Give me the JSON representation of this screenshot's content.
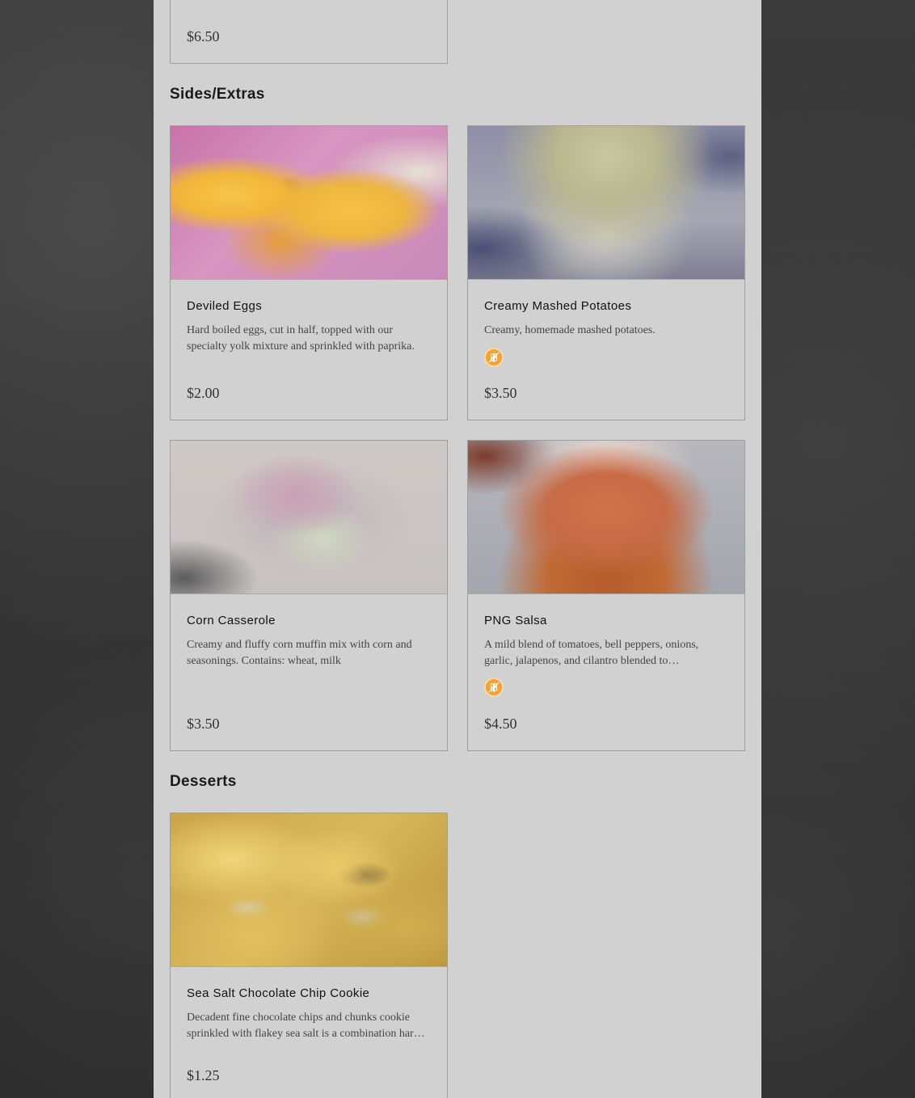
{
  "top_card": {
    "price": "$6.50"
  },
  "sections": [
    {
      "title": "Sides/Extras",
      "items": [
        {
          "name": "Deviled Eggs",
          "description": "Hard boiled eggs, cut in half, topped with our specialty yolk mixture and sprinkled with paprika.",
          "price": "$2.00",
          "badge": ""
        },
        {
          "name": "Creamy Mashed Potatoes",
          "description": "Creamy, homemade mashed potatoes.",
          "price": "$3.50",
          "badge": "gluten-free-icon"
        },
        {
          "name": "Corn Casserole",
          "description": "Creamy and fluffy corn muffin mix with corn and seasonings. Contains: wheat, milk",
          "price": "$3.50",
          "badge": ""
        },
        {
          "name": "PNG Salsa",
          "description": "A mild blend of tomatoes, bell peppers, onions, garlic, jalapenos, and cilantro blended to…",
          "price": "$4.50",
          "badge": "gluten-free-icon"
        }
      ]
    },
    {
      "title": "Desserts",
      "items": [
        {
          "name": "Sea Salt Chocolate Chip Cookie",
          "description": "Decadent fine chocolate chips and chunks cookie sprinkled with flakey sea salt is a combination har…",
          "price": "$1.25",
          "badge": ""
        }
      ]
    }
  ],
  "colors": {
    "panel": "#d1d1d1",
    "badge": "#f2a33a",
    "background": "#2b2b2b"
  }
}
